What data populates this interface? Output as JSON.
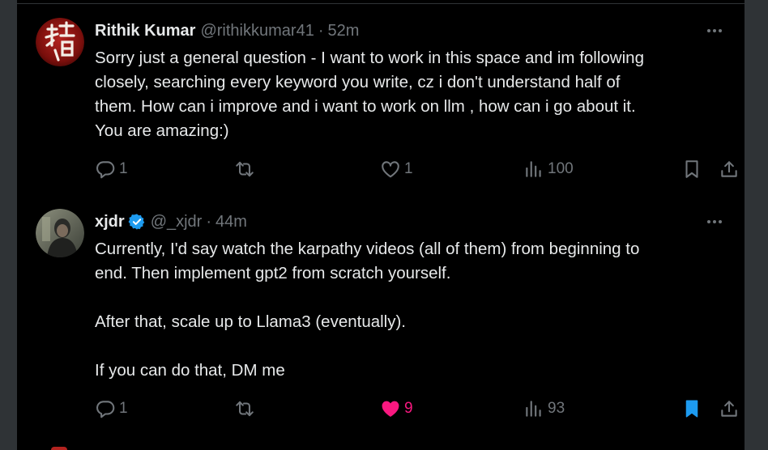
{
  "tweets": [
    {
      "name": "Rithik Kumar",
      "verified": false,
      "handle": "@rithikkumar41",
      "separator": "·",
      "time": "52m",
      "lines": [
        "Sorry just a general question - I want to work in this space and im following",
        "closely, searching every keyword you write, cz i don't understand half of",
        "them. How can i improve and i want to work on llm , how can i go about it.",
        "You are amazing:)"
      ],
      "replies": "1",
      "retweets": "",
      "likes": "1",
      "liked": false,
      "views": "100",
      "bookmarked": false,
      "icons": {
        "reply": "reply-icon",
        "retweet": "retweet-icon",
        "like": "heart-icon",
        "views": "views-icon",
        "bookmark": "bookmark-icon",
        "share": "share-icon"
      }
    },
    {
      "name": "xjdr",
      "verified": true,
      "handle": "@_xjdr",
      "separator": "·",
      "time": "44m",
      "lines": [
        "Currently, I'd say watch the karpathy videos (all of them) from beginning to",
        "end. Then implement gpt2 from scratch yourself.",
        "",
        "After that, scale up to Llama3 (eventually).",
        "",
        "If you can do that, DM me"
      ],
      "replies": "1",
      "retweets": "",
      "likes": "9",
      "liked": true,
      "views": "93",
      "bookmarked": true,
      "icons": {
        "reply": "reply-icon",
        "retweet": "retweet-icon",
        "like": "heart-filled-icon",
        "views": "views-icon",
        "bookmark": "bookmark-filled-icon",
        "share": "share-icon"
      }
    }
  ],
  "colors": {
    "background": "#000000",
    "text": "#e7e9ea",
    "muted": "#71767b",
    "like_active": "#f91880",
    "bookmark_active": "#1d9bf0",
    "verified": "#1d9bf0"
  }
}
